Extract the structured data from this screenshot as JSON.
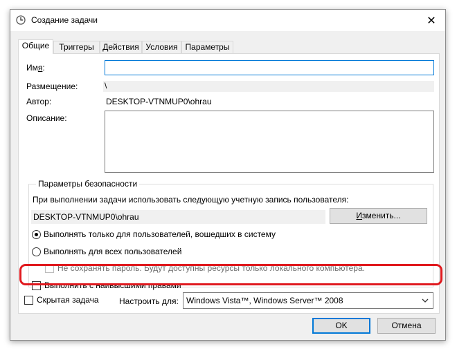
{
  "window": {
    "title": "Создание задачи",
    "close_glyph": "✕"
  },
  "tabs": [
    {
      "label": "Общие",
      "active": true
    },
    {
      "label": "Триггеры",
      "active": false
    },
    {
      "label": "Действия",
      "active": false
    },
    {
      "label": "Условия",
      "active": false
    },
    {
      "label": "Параметры",
      "active": false
    }
  ],
  "general": {
    "name_label_pre": "Им",
    "name_label_ul": "я",
    "name_label_post": ":",
    "name_value": "",
    "location_label": "Размещение:",
    "location_value": "\\",
    "author_label": "Автор:",
    "author_value": "DESKTOP-VTNMUP0\\ohrau",
    "description_label": "Описание:",
    "description_value": ""
  },
  "security": {
    "group_title": "Параметры безопасности",
    "account_prompt": "При выполнении задачи использовать следующую учетную запись пользователя:",
    "account_value": "DESKTOP-VTNMUP0\\ohrau",
    "change_button_pre": "",
    "change_button_ul": "И",
    "change_button_post": "зменить...",
    "radio_logged_on": "Выполнять только для пользователей, вошедших в систему",
    "radio_logged_on_checked": true,
    "radio_all_users": "Выполнять для всех пользователей",
    "radio_all_users_checked": false,
    "no_store_password": "Не сохранять пароль. Будут доступны ресурсы только локального компьютера.",
    "highest_privileges": "Выполнить с наивысшими правами",
    "highest_privileges_checked": false
  },
  "bottom": {
    "hidden_label": "Скрытая задача",
    "configure_label": "Настроить для:",
    "configure_value": "Windows Vista™, Windows Server™ 2008"
  },
  "buttons": {
    "ok": "OK",
    "cancel": "Отмена"
  },
  "colors": {
    "accent": "#0078d7",
    "highlight": "#e0191e"
  },
  "icons": {
    "title": "clock-icon",
    "dropdown": "chevron-down-icon"
  }
}
